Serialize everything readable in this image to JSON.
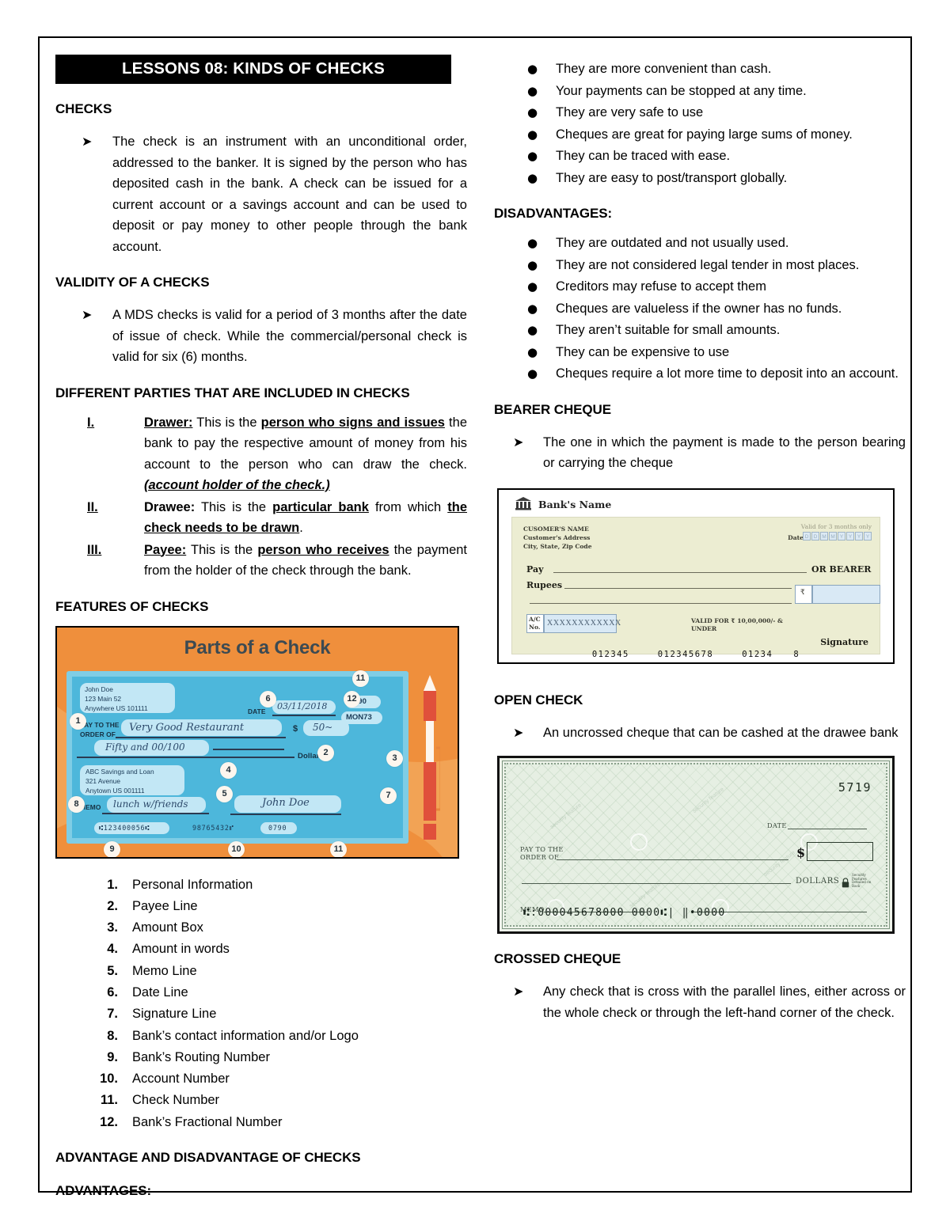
{
  "document": {
    "title": "LESSONS 08: KINDS OF CHECKS"
  },
  "left_column": {
    "headings": {
      "checks": "CHECKS",
      "validity": "VALIDITY OF A CHECKS",
      "parties": "DIFFERENT PARTIES THAT ARE INCLUDED IN CHECKS",
      "features": "FEATURES OF CHECKS",
      "adv_disadv": "ADVANTAGE AND DISADVANTAGE OF CHECKS",
      "advantages": "ADVANTAGES:"
    },
    "checks_body": "The check is an instrument with an unconditional order, addressed to the banker. It is signed by the person who has deposited cash in the bank. A check can be issued for a current account or a savings account and can be used to deposit or pay money to other people through the bank account.",
    "validity_body": "A MDS checks is valid for a period of 3 months after the date of issue of check. While the commercial/personal check is valid for six (6) months.",
    "parties": [
      {
        "numeral": "I.",
        "term": "Drawer:",
        "text_1": " This is the ",
        "bold_1": "person who signs and issues",
        "text_2": " the bank to pay the respective amount of money from his account to the person who can draw the check. ",
        "italic_tail": "(account holder of the check.)"
      },
      {
        "numeral": "II.",
        "term": "Drawee:",
        "text_1": " This is the ",
        "bold_1": "particular bank",
        "text_2": " from which ",
        "bold_2": "the check needs to be drawn",
        "text_3": "."
      },
      {
        "numeral": "III.",
        "term": "Payee:",
        "text_1": " This is the ",
        "bold_1": "person who receives",
        "text_2": " the payment from the holder of the check through the bank."
      }
    ],
    "parts_numbered": [
      {
        "n": "1.",
        "label": "Personal Information"
      },
      {
        "n": "2.",
        "label": "Payee Line"
      },
      {
        "n": "3.",
        "label": "Amount Box"
      },
      {
        "n": "4.",
        "label": "Amount in words"
      },
      {
        "n": "5.",
        "label": "Memo Line"
      },
      {
        "n": "6.",
        "label": "Date Line"
      },
      {
        "n": "7.",
        "label": "Signature Line"
      },
      {
        "n": "8.",
        "label": "Bank’s contact information and/or Logo"
      },
      {
        "n": "9.",
        "label": "Bank’s Routing Number"
      },
      {
        "n": "10.",
        "label": "Account Number"
      },
      {
        "n": "11.",
        "label": "Check Number"
      },
      {
        "n": "12.",
        "label": "Bank’s Fractional Number"
      }
    ]
  },
  "parts_of_check_image": {
    "title": "Parts of a Check",
    "payer_name": "John Doe",
    "payer_street": "123 Main 52",
    "payer_city": "Anywhere US 101111",
    "date_label": "DATE",
    "date_value": "03/11/2018",
    "check_number": "790",
    "fractional_number": "MON73",
    "pay_to_label_1": "PAY TO THE",
    "pay_to_label_2": "ORDER OF",
    "payee_value": "Very Good Restaurant",
    "dollar_sign": "$",
    "amount_value": "50~",
    "dollars_label": "Dollars",
    "amount_words": "Fifty and 00/100",
    "bank_name": "ABC Savings and Loan",
    "bank_street": "321 Avenue",
    "bank_city": "Anytown US 001111",
    "memo_label": "MEMO",
    "memo_value": "lunch w/friends",
    "signature_value": "John Doe",
    "routing_micr": "⑆123400056⑆",
    "account_micr": "98765432⑈",
    "checknum_micr": "0790",
    "callouts": [
      "1",
      "2",
      "3",
      "4",
      "5",
      "6",
      "7",
      "8",
      "9",
      "10",
      "11",
      "12",
      "11"
    ],
    "colors": {
      "background": "#f2a355",
      "check_body": "#4db7db",
      "check_border": "#7fcde5",
      "field": "#c2e7f5",
      "title": "#3c4a52",
      "pen_red": "#e0503b"
    }
  },
  "right_column": {
    "advantages": [
      "They are more convenient than cash.",
      "Your payments can be stopped at any time.",
      "They are very safe to use",
      "Cheques are great for paying large sums of money.",
      "They can be traced with ease.",
      "They are easy to post/transport globally."
    ],
    "headings": {
      "disadvantages": "DISADVANTAGES:",
      "bearer": "BEARER CHEQUE",
      "open": "OPEN CHECK",
      "crossed": "CROSSED CHEQUE"
    },
    "disadvantages": [
      "They are outdated and not usually used.",
      "They are not considered legal tender in most places.",
      "Creditors may refuse to accept them",
      "Cheques are valueless if the owner has no funds.",
      "They aren’t suitable for small amounts.",
      "They can be expensive to use",
      "Cheques require a lot more time to deposit into an account."
    ],
    "bearer_body": "The one in which the payment is made to the person bearing or carrying the cheque",
    "open_body": "An uncrossed cheque that can be cashed at the drawee bank",
    "crossed_body": "Any check that is cross with the parallel lines, either across or the whole check or through the left-hand corner of the check."
  },
  "bearer_cheque_image": {
    "bank_name": "Bank's Name",
    "customer_name": "CUSOMER'S NAME",
    "customer_address": "Customer's Address",
    "customer_city": "City, State, Zip Code",
    "valid_note": "Valid for 3 months only",
    "date_label": "Date",
    "date_boxes": [
      "D",
      "D",
      "M",
      "M",
      "Y",
      "Y",
      "Y",
      "Y"
    ],
    "pay_label": "Pay",
    "or_bearer_label": "OR BEARER",
    "rupees_label": "Rupees",
    "rupee_symbol": "₹",
    "ac_label_1": "A/C",
    "ac_label_2": "No.",
    "ac_value": "XXXXXXXXXXXX",
    "valid_for_1": "VALID FOR ₹ 10,00,000/- &",
    "valid_for_2": "UNDER",
    "signature_label": "Signature",
    "micr": [
      "012345",
      "012345678",
      "01234",
      "8"
    ],
    "colors": {
      "paper": "#ecedd2",
      "field": "#d9e9f5"
    }
  },
  "open_check_image": {
    "check_number": "5719",
    "date_label": "DATE",
    "pay_to_label_1": "PAY TO THE",
    "pay_to_label_2": "ORDER OF",
    "dollar_sign": "$",
    "dollars_label": "DOLLARS",
    "memo_label": "MEMO",
    "security_note_1": "Security",
    "security_note_2": "Features",
    "security_note_3": "Detailed on",
    "security_note_4": "Back",
    "micr": "⑆:000045678000   0000⑆|   ‖•0000",
    "watermark": "security feature",
    "colors": {
      "paper": "#e6efe3",
      "ink": "#2b3a2d"
    }
  }
}
